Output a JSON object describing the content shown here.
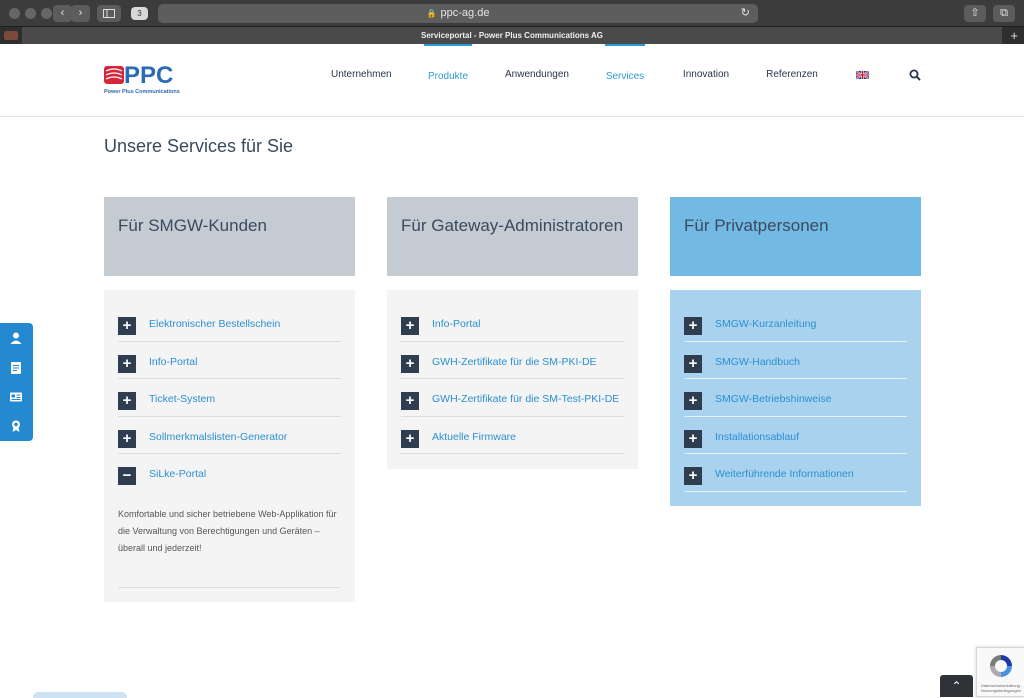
{
  "browser": {
    "url": "ppc-ag.de",
    "tab_title": "Serviceportal - Power Plus Communications AG",
    "tab_count": "3"
  },
  "header": {
    "logo_text": "PPC",
    "logo_sub": "Power Plus Communications",
    "nav": [
      {
        "label": "Unternehmen"
      },
      {
        "label": "Produkte"
      },
      {
        "label": "Anwendungen"
      },
      {
        "label": "Services"
      },
      {
        "label": "Innovation"
      },
      {
        "label": "Referenzen"
      }
    ]
  },
  "main": {
    "title": "Unsere Services für Sie",
    "columns": [
      {
        "heading": "Für SMGW-Kunden",
        "items": [
          {
            "icon": "+",
            "label": "Elektronischer Bestellschein"
          },
          {
            "icon": "+",
            "label": "Info-Portal"
          },
          {
            "icon": "+",
            "label": "Ticket-System"
          },
          {
            "icon": "+",
            "label": "Sollmerkmalslisten-Generator"
          },
          {
            "icon": "−",
            "label": "SiLke-Portal"
          }
        ],
        "description": "Komfortable und sicher betriebene Web-Applikation für die Verwaltung von Berechtigungen und Geräten – überall und jederzeit!"
      },
      {
        "heading": "Für Gateway-Administratoren",
        "items": [
          {
            "icon": "+",
            "label": "Info-Portal"
          },
          {
            "icon": "+",
            "label": "GWH-Zertifikate für die SM-PKI-DE"
          },
          {
            "icon": "+",
            "label": "GWH-Zertifikate für die SM-Test-PKI-DE"
          },
          {
            "icon": "+",
            "label": "Aktuelle Firmware"
          }
        ]
      },
      {
        "heading": "Für Privatpersonen",
        "items": [
          {
            "icon": "+",
            "label": "SMGW-Kurzanleitung"
          },
          {
            "icon": "+",
            "label": "SMGW-Handbuch"
          },
          {
            "icon": "+",
            "label": "SMGW-Betriebshinweise"
          },
          {
            "icon": "+",
            "label": "Installationsablauf"
          },
          {
            "icon": "+",
            "label": "Weiterführende Informationen"
          }
        ]
      }
    ]
  },
  "captcha": {
    "text": "Datenschutzerklärung - Nutzungsbedingungen"
  },
  "colors": {
    "accent": "#2d9ad8",
    "dark": "#2e3d50",
    "grey_head": "#c5cbd3",
    "blue_head": "#72b9e4",
    "blue_panel": "#a9d2ef"
  },
  "icons": {
    "side": [
      "user-icon",
      "document-icon",
      "id-card-icon",
      "certificate-icon"
    ],
    "search": "search-icon",
    "scroll": "chevron-up-icon"
  }
}
